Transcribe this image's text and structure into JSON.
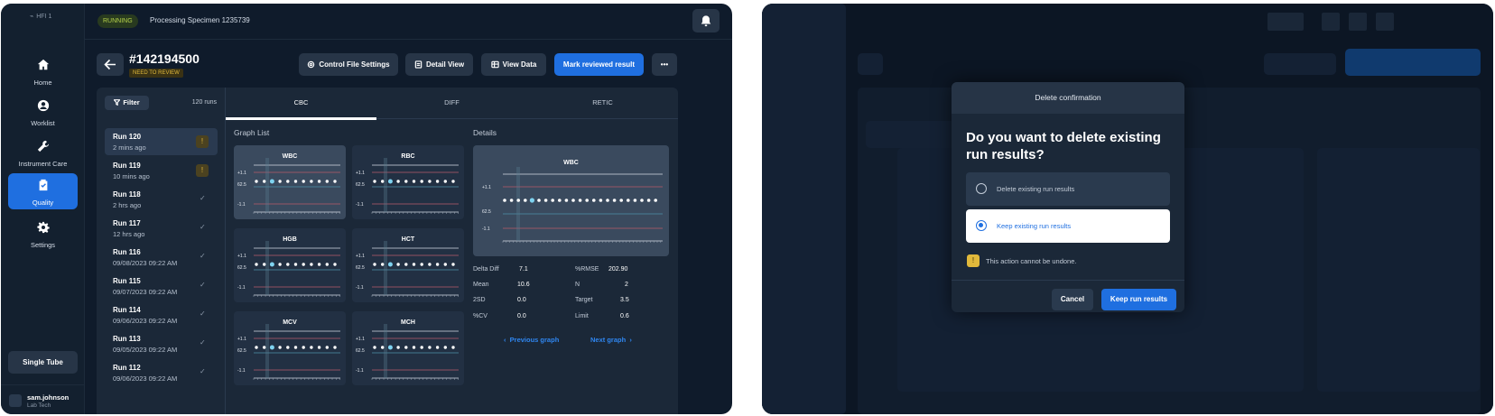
{
  "sidebar": {
    "brand": "HFI 1",
    "items": [
      {
        "label": "Home",
        "icon": "home-icon"
      },
      {
        "label": "Worklist",
        "icon": "user-icon"
      },
      {
        "label": "Instrument Care",
        "icon": "wrench-icon"
      },
      {
        "label": "Quality",
        "icon": "clipboard-check-icon"
      },
      {
        "label": "Settings",
        "icon": "gear-icon"
      }
    ],
    "single_tube": "Single Tube",
    "user": {
      "name": "sam.johnson",
      "role": "Lab Tech"
    }
  },
  "topbar": {
    "status": "RUNNING",
    "process": "Processing Specimen 1235739"
  },
  "header": {
    "run_id": "#142194500",
    "review_badge": "NEED TO REVIEW",
    "buttons": {
      "control_file": "Control File Settings",
      "detail_view": "Detail View",
      "view_data": "View Data",
      "mark_reviewed": "Mark reviewed result",
      "more": "•••"
    }
  },
  "runs": {
    "filter_label": "Filter",
    "count": "120 runs",
    "items": [
      {
        "title": "Run 120",
        "time": "2 mins ago",
        "status": "warning"
      },
      {
        "title": "Run 119",
        "time": "10 mins ago",
        "status": "warning"
      },
      {
        "title": "Run 118",
        "time": "2 hrs ago",
        "status": "ok"
      },
      {
        "title": "Run 117",
        "time": "12 hrs ago",
        "status": "ok"
      },
      {
        "title": "Run 116",
        "time": "09/08/2023 09:22 AM",
        "status": "ok"
      },
      {
        "title": "Run 115",
        "time": "09/07/2023 09:22 AM",
        "status": "ok"
      },
      {
        "title": "Run 114",
        "time": "09/06/2023 09:22 AM",
        "status": "ok"
      },
      {
        "title": "Run 113",
        "time": "09/05/2023 09:22 AM",
        "status": "ok"
      },
      {
        "title": "Run 112",
        "time": "09/06/2023 09:22 AM",
        "status": "ok"
      }
    ]
  },
  "tabs": [
    "CBC",
    "DIFF",
    "RETIC"
  ],
  "graph_list": {
    "title": "Graph List",
    "axis_labels": [
      "+1.1",
      "62.5",
      "-1.1"
    ],
    "graphs": [
      "WBC",
      "RBC",
      "HGB",
      "HCT",
      "MCV",
      "MCH"
    ]
  },
  "details": {
    "title": "Details",
    "graph": "WBC",
    "axis_labels": [
      "+1.1",
      "62.5",
      "-1.1"
    ],
    "stats": [
      {
        "label": "Delta Diff",
        "value": "7.1"
      },
      {
        "label": "%RMSE",
        "value": "202.90"
      },
      {
        "label": "Mean",
        "value": "10.6"
      },
      {
        "label": "N",
        "value": "2"
      },
      {
        "label": "2SD",
        "value": "0.0"
      },
      {
        "label": "Target",
        "value": "3.5"
      },
      {
        "label": "%CV",
        "value": "0.0"
      },
      {
        "label": "Limit",
        "value": "0.6"
      }
    ],
    "prev": "Previous graph",
    "next": "Next graph"
  },
  "modal": {
    "title": "Delete confirmation",
    "question": "Do you want to delete existing run results?",
    "options": [
      {
        "label": "Delete existing run results",
        "selected": false
      },
      {
        "label": "Keep existing run results",
        "selected": true
      }
    ],
    "note": "This action cannot be undone.",
    "cancel": "Cancel",
    "confirm": "Keep run results"
  },
  "colors": {
    "accent": "#1f6fe0",
    "warning": "#e1b93b",
    "running": "#b6d24a"
  }
}
